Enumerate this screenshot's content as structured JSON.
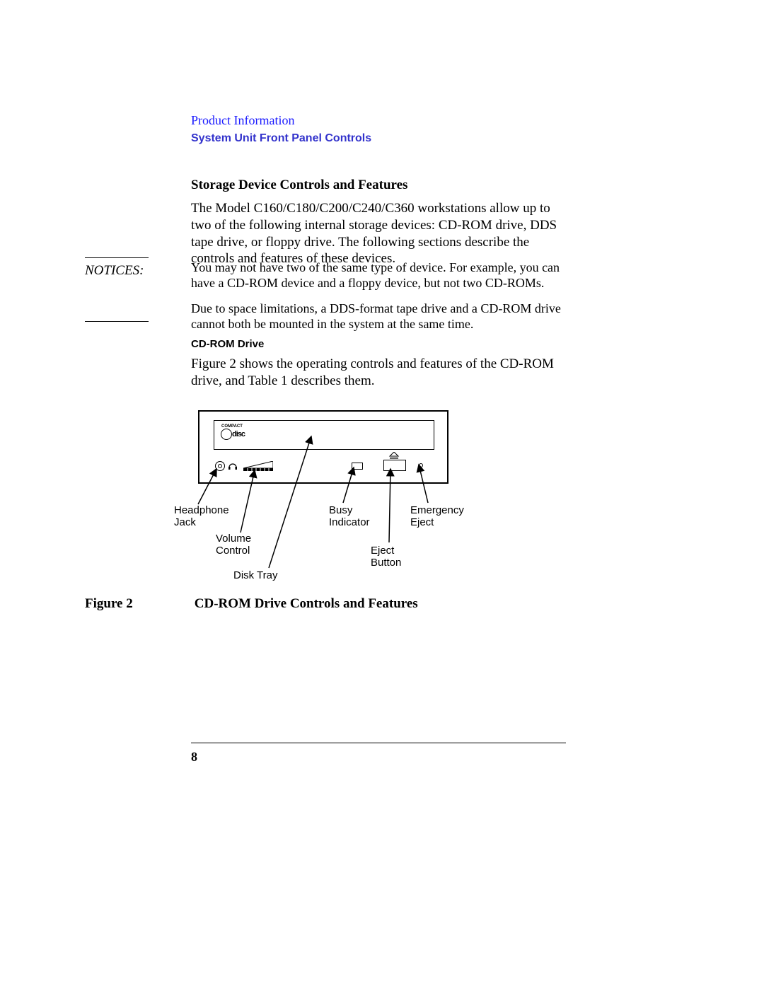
{
  "header": {
    "product_info": "Product Information",
    "subhead": "System Unit Front Panel Controls"
  },
  "section": {
    "title": "Storage Device Controls and Features",
    "intro": "The Model C160/C180/C200/C240/C360 workstations allow up to two of the following internal storage devices: CD-ROM drive, DDS tape drive, or floppy drive. The following sections describe the controls and features of these devices."
  },
  "notices": {
    "label": "NOTICES:",
    "para1": "You may not have two of the same type of device. For example, you can have a CD-ROM device and a floppy device, but not two CD-ROMs.",
    "para2": "Due to space limitations, a DDS-format tape drive and a CD-ROM drive cannot both be mounted in the system at the same time."
  },
  "cdrom": {
    "heading": "CD-ROM Drive",
    "intro": "Figure 2 shows the operating controls and features of the CD-ROM drive, and Table 1 describes them."
  },
  "figure": {
    "label": "Figure 2",
    "caption": "CD-ROM Drive Controls and Features",
    "callouts": {
      "headphone": "Headphone\nJack",
      "volume": "Volume\nControl",
      "disktray": "Disk Tray",
      "busy": "Busy\nIndicator",
      "eject": "Eject\nButton",
      "emergency": "Emergency\nEject"
    },
    "logo": {
      "compact": "COMPACT",
      "disc": "disc"
    }
  },
  "page_number": "8"
}
